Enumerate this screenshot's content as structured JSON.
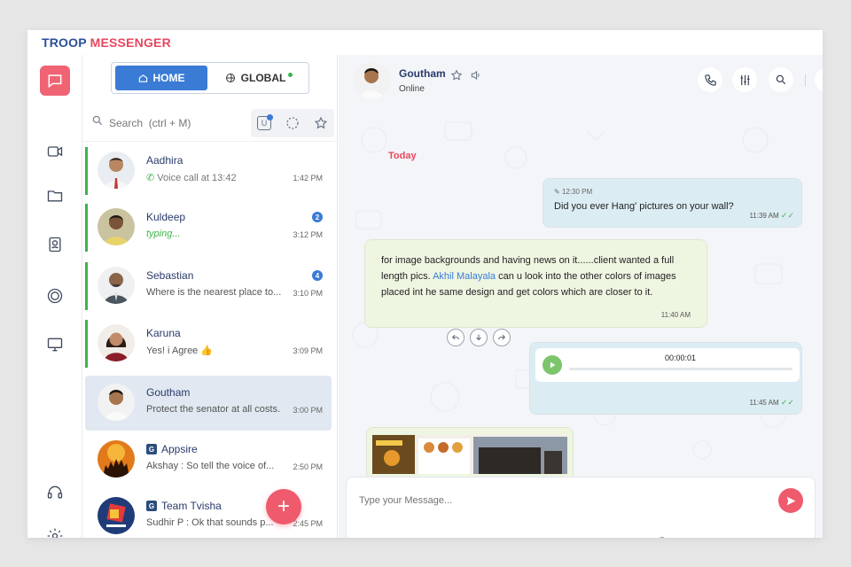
{
  "brand": {
    "part1": "TROOP",
    "part2": " MESSENGER"
  },
  "rail": {
    "icons": [
      "chat-icon",
      "video-icon",
      "folder-icon",
      "contacts-icon",
      "circle-icon",
      "monitor-icon",
      "headset-icon",
      "settings-icon"
    ],
    "active_color": "#ef6373"
  },
  "tabs": {
    "home": "HOME",
    "global": "GLOBAL"
  },
  "search": {
    "placeholder": "Search  (ctrl + M)",
    "filter_u": "U"
  },
  "chats": [
    {
      "name": "Aadhira",
      "preview": "Voice call at 13:42",
      "time": "1:42 PM",
      "kind": "call"
    },
    {
      "name": "Kuldeep",
      "preview": "typing...",
      "time": "3:12 PM",
      "unread": "2",
      "kind": "typing"
    },
    {
      "name": "Sebastian",
      "preview": "Where is the nearest place to...",
      "time": "3:10 PM",
      "unread": "4"
    },
    {
      "name": "Karuna",
      "preview": "Yes! i Agree 👍",
      "time": "3:09 PM"
    },
    {
      "name": "Goutham",
      "preview": "Protect the senator at all costs.",
      "time": "3:00 PM",
      "selected": true
    },
    {
      "name": "Appsire",
      "preview": "Akshay  : So tell the voice of...",
      "time": "2:50 PM",
      "group": true
    },
    {
      "name": "Team Tvisha",
      "preview": "Sudhir P : Ok that sounds p...",
      "time": "2:45 PM",
      "group": true
    }
  ],
  "conversation": {
    "name": "Goutham",
    "status": "Online",
    "date_label": "Today",
    "messages": [
      {
        "dir": "out",
        "edited_time": "12:30 PM",
        "text": "Did you ever Hang' pictures on your wall?",
        "time": "11:39 AM"
      },
      {
        "dir": "in",
        "text_before": "for image backgrounds and having news on it......client wanted a full length pics. ",
        "mention": "Akhil Malayala",
        "text_after": " can u look into the other colors of images placed int he same design and get colors which are closer to it.",
        "time": "11:40 AM"
      },
      {
        "dir": "out",
        "audio_duration": "00:00:01",
        "time": "11:45 AM"
      }
    ]
  },
  "composer": {
    "placeholder": "Type your Message..."
  },
  "colors": {
    "accent": "#3a7bd5",
    "brand_red": "#e8475f",
    "online": "#3bb54a"
  }
}
